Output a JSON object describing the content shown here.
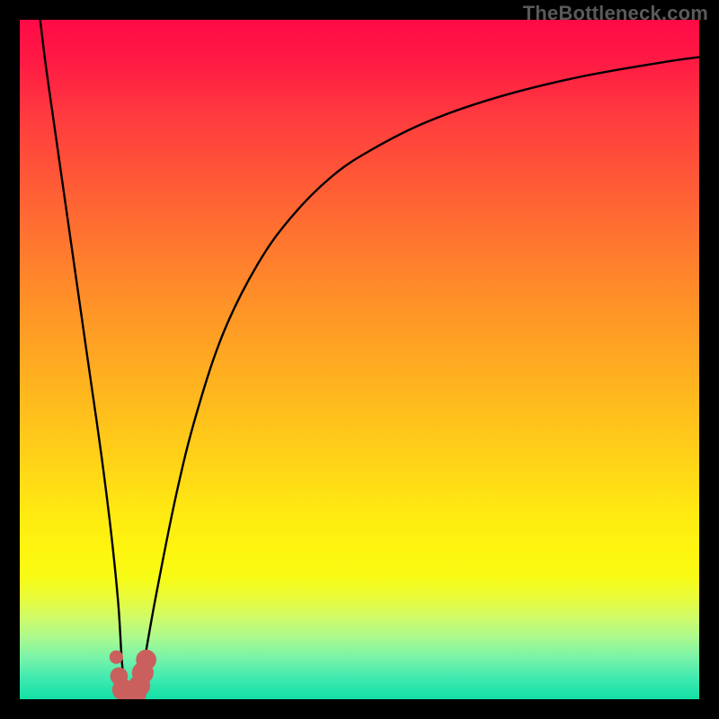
{
  "watermark": {
    "text": "TheBottleneck.com"
  },
  "chart_data": {
    "type": "line",
    "title": "",
    "xlabel": "",
    "ylabel": "",
    "xlim": [
      0,
      100
    ],
    "ylim": [
      0,
      100
    ],
    "grid": false,
    "legend": false,
    "colors": {
      "gradient_top": "#ff0a46",
      "gradient_bottom": "#12e0a6",
      "curve": "#000000",
      "marker": "#c9605d"
    },
    "series": [
      {
        "name": "bottleneck-curve",
        "x": [
          3,
          4,
          6,
          8,
          10,
          12,
          13.5,
          14.5,
          15,
          15.5,
          16,
          17,
          18,
          20,
          23,
          26,
          30,
          35,
          40,
          46,
          52,
          60,
          70,
          82,
          95,
          100
        ],
        "y": [
          100,
          92,
          78,
          64,
          50,
          36,
          24,
          14,
          6,
          1,
          0.5,
          1,
          4,
          15,
          30,
          42,
          54,
          64,
          71,
          77,
          81,
          85,
          88.5,
          91.5,
          93.8,
          94.5
        ]
      }
    ],
    "markers": [
      {
        "x": 14.2,
        "y": 6.2,
        "r": 1.0
      },
      {
        "x": 14.6,
        "y": 3.4,
        "r": 1.3
      },
      {
        "x": 15.2,
        "y": 1.4,
        "r": 1.6
      },
      {
        "x": 16.1,
        "y": 0.6,
        "r": 1.6
      },
      {
        "x": 17.0,
        "y": 0.7,
        "r": 1.6
      },
      {
        "x": 17.6,
        "y": 2.0,
        "r": 1.6
      },
      {
        "x": 18.1,
        "y": 3.9,
        "r": 1.6
      },
      {
        "x": 18.6,
        "y": 5.8,
        "r": 1.5
      }
    ]
  }
}
